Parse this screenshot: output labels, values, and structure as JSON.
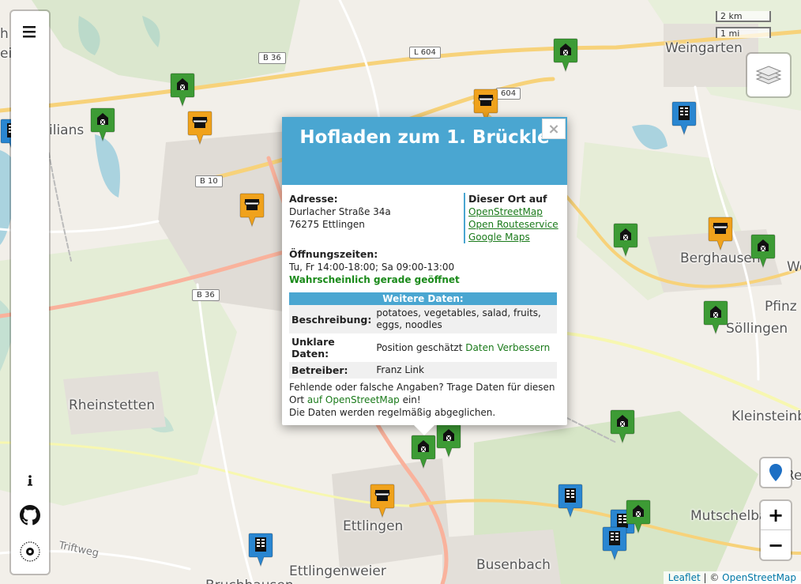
{
  "map": {
    "places": [
      {
        "name": "Weingarten"
      },
      {
        "name": "Berghausen"
      },
      {
        "name": "Pfinz"
      },
      {
        "name": "Söllingen"
      },
      {
        "name": "Kleinsteinb"
      },
      {
        "name": "Mutschelba"
      },
      {
        "name": "Re"
      },
      {
        "name": "Rheinstetten"
      },
      {
        "name": "Ettlingen"
      },
      {
        "name": "Busenbach"
      },
      {
        "name": "Ettlingenweier"
      },
      {
        "name": "Bruchhausen"
      },
      {
        "name": "Triftweg"
      },
      {
        "name": "ilians"
      },
      {
        "name": "We"
      },
      {
        "name": "h a"
      },
      {
        "name": "ein"
      }
    ],
    "roads": [
      "B 36",
      "L 604",
      "604",
      "B 10",
      "B 36"
    ],
    "markers": [
      {
        "type": "farm",
        "color": "#3d9b35"
      },
      {
        "type": "farm",
        "color": "#3d9b35"
      },
      {
        "type": "farm",
        "color": "#3d9b35"
      },
      {
        "type": "shop",
        "color": "#f0a21c"
      },
      {
        "type": "shop",
        "color": "#f0a21c"
      },
      {
        "type": "shop",
        "color": "#f0a21c"
      },
      {
        "type": "vending",
        "color": "#2a86d1"
      },
      {
        "type": "vending",
        "color": "#2a86d1"
      },
      {
        "type": "farm",
        "color": "#3d9b35"
      },
      {
        "type": "shop",
        "color": "#f0a21c"
      },
      {
        "type": "farm",
        "color": "#3d9b35"
      },
      {
        "type": "farm",
        "color": "#3d9b35"
      },
      {
        "type": "farm",
        "color": "#3d9b35"
      },
      {
        "type": "farm",
        "color": "#3d9b35"
      },
      {
        "type": "farm",
        "color": "#3d9b35"
      },
      {
        "type": "shop",
        "color": "#f0a21c"
      },
      {
        "type": "vending",
        "color": "#2a86d1"
      },
      {
        "type": "vending",
        "color": "#2a86d1"
      },
      {
        "type": "vending",
        "color": "#2a86d1"
      },
      {
        "type": "farm",
        "color": "#3d9b35"
      },
      {
        "type": "vending",
        "color": "#2a86d1"
      }
    ]
  },
  "scale": {
    "km": "2 km",
    "mi": "1 mi"
  },
  "sidebar": {
    "menu_icon": "hamburger-icon",
    "info_icon": "info-icon",
    "github_icon": "github-icon",
    "logo_icon": "logo-icon"
  },
  "controls": {
    "layers_icon": "layers-icon",
    "locate_icon": "map-pin-icon",
    "zoom_in": "+",
    "zoom_out": "−"
  },
  "attribution": {
    "leaflet": "Leaflet",
    "sep": " | © ",
    "osm": "OpenStreetMap"
  },
  "popup": {
    "title": "Hofladen zum 1. Brückle",
    "close": "×",
    "address_label": "Adresse:",
    "street": "Durlacher Straße 34a",
    "city": "76275 Ettlingen",
    "links_label": "Dieser Ort auf",
    "links": [
      "OpenStreetMap",
      "Open Routeservice",
      "Google Maps"
    ],
    "hours_label": "Öffnungszeiten:",
    "hours": "Tu, Fr 14:00-18:00; Sa 09:00-13:00",
    "open_status": "Wahrscheinlich gerade geöffnet",
    "more_label": "Weitere Daten:",
    "rows": [
      {
        "key": "Beschreibung:",
        "value": "potatoes, vegetables, salad, fruits, eggs, noodles"
      },
      {
        "key": "Unklare Daten:",
        "value": "Position geschätzt",
        "link": "Daten Verbessern"
      },
      {
        "key": "Betreiber:",
        "value": "Franz Link"
      }
    ],
    "footer1": "Fehlende oder falsche Angaben? Trage Daten für diesen Ort",
    "footer_link": "auf OpenStreetMap",
    "footer2": "ein!",
    "footer3": "Die Daten werden regelmäßig abgeglichen."
  }
}
